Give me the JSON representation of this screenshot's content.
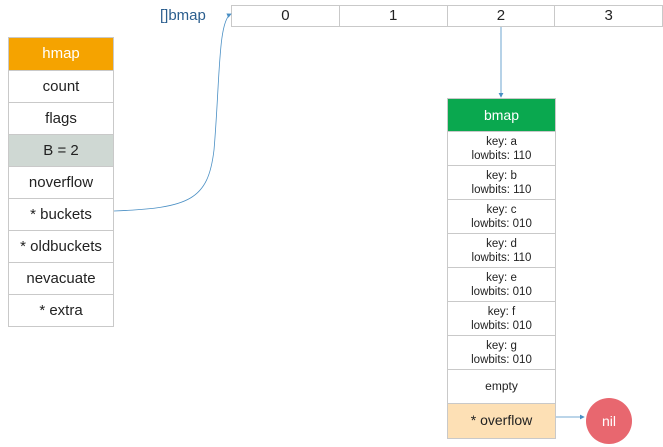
{
  "hmap": {
    "header": "hmap",
    "fields": [
      "count",
      "flags",
      "B = 2",
      "noverflow",
      "* buckets",
      "* oldbuckets",
      "nevacuate",
      "* extra"
    ]
  },
  "array": {
    "label": "[]bmap",
    "cells": [
      "0",
      "1",
      "2",
      "3"
    ]
  },
  "bmap": {
    "header": "bmap",
    "entries": [
      {
        "key": "key: a",
        "lowbits": "lowbits: 110"
      },
      {
        "key": "key: b",
        "lowbits": "lowbits: 110"
      },
      {
        "key": "key: c",
        "lowbits": "lowbits: 010"
      },
      {
        "key": "key: d",
        "lowbits": "lowbits: 110"
      },
      {
        "key": "key: e",
        "lowbits": "lowbits: 010"
      },
      {
        "key": "key: f",
        "lowbits": "lowbits: 010"
      },
      {
        "key": "key: g",
        "lowbits": "lowbits: 010"
      }
    ],
    "empty": "empty",
    "overflow": "* overflow"
  },
  "nil_label": "nil",
  "colors": {
    "hmap_header": "#f5a300",
    "bmap_header": "#0aa84f",
    "highlight": "#cfd8d3",
    "overflow": "#fde0b5",
    "nil": "#e8676f",
    "wire": "#4a8fc4"
  }
}
